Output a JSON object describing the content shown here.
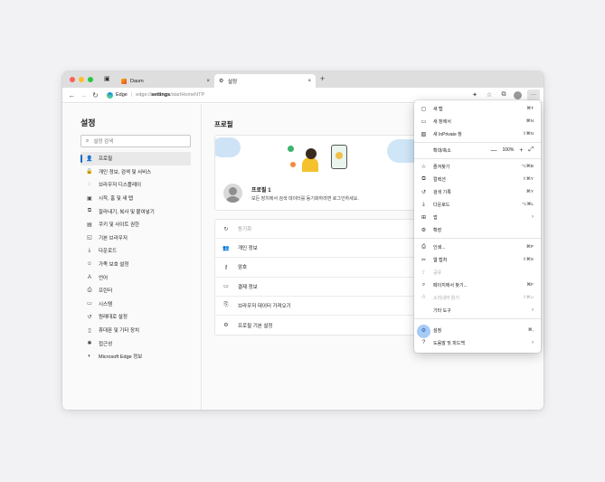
{
  "window": {
    "tabs": [
      {
        "title": "Daum",
        "close": "×"
      },
      {
        "title": "설정",
        "close": "×"
      }
    ],
    "new_tab": "+",
    "address": {
      "browser": "Edge",
      "url_prefix": "edge://",
      "url_bold": "settings",
      "url_rest": "/startHomeNTP"
    }
  },
  "sidebar": {
    "title": "설정",
    "search_placeholder": "설정 검색",
    "items": [
      {
        "label": "프로필",
        "icon": "👤"
      },
      {
        "label": "개인 정보, 검색 및 서비스",
        "icon": "🔒"
      },
      {
        "label": "브라우저 디스플레이",
        "icon": "◌"
      },
      {
        "label": "시작, 홈 및 새 탭",
        "icon": "▣"
      },
      {
        "label": "잘라내기, 복사 및 붙여넣기",
        "icon": "⧉"
      },
      {
        "label": "쿠키 및 사이트 권한",
        "icon": "▤"
      },
      {
        "label": "기본 브라우저",
        "icon": "◱"
      },
      {
        "label": "다운로드",
        "icon": "⤓"
      },
      {
        "label": "가족 보호 설정",
        "icon": "☺"
      },
      {
        "label": "언어",
        "icon": "A"
      },
      {
        "label": "프린터",
        "icon": "⎙"
      },
      {
        "label": "시스템",
        "icon": "▭"
      },
      {
        "label": "원래대로 설정",
        "icon": "↺"
      },
      {
        "label": "휴대폰 및 기타 장치",
        "icon": "▯"
      },
      {
        "label": "접근성",
        "icon": "✱"
      },
      {
        "label": "Microsoft Edge 정보",
        "icon": "◐"
      }
    ]
  },
  "main": {
    "title": "프로필",
    "profile": {
      "name": "프로필 1",
      "desc": "모든 장치에서 검색 데이터를 동기화하려면 로그인하세요."
    },
    "rows": [
      {
        "label": "동기화",
        "icon": "↻"
      },
      {
        "label": "개인 정보",
        "icon": "👥"
      },
      {
        "label": "암호",
        "icon": "⚷"
      },
      {
        "label": "결제 정보",
        "icon": "▭"
      },
      {
        "label": "브라우저 데이터 가져오기",
        "icon": "⎘"
      },
      {
        "label": "프로필 기본 설정",
        "icon": "⚙"
      }
    ]
  },
  "menu": {
    "items": [
      {
        "label": "새 탭",
        "shortcut": "⌘T",
        "icon": "▢"
      },
      {
        "label": "새 창에서",
        "shortcut": "⌘N",
        "icon": "▭"
      },
      {
        "label": "새 InPrivate 창",
        "shortcut": "⇧⌘N",
        "icon": "▨"
      },
      {
        "label": "확대/축소",
        "zoom_minus": "—",
        "zoom_value": "100%",
        "zoom_plus": "+",
        "zoom_full": "⤢"
      },
      {
        "label": "즐겨찾기",
        "shortcut": "⌥⌘B",
        "icon": "☆"
      },
      {
        "label": "컬렉션",
        "shortcut": "⇧⌘Y",
        "icon": "⧉"
      },
      {
        "label": "검색 기록",
        "shortcut": "⌘Y",
        "icon": "↺"
      },
      {
        "label": "다운로드",
        "shortcut": "⌥⌘L",
        "icon": "⤓"
      },
      {
        "label": "앱",
        "icon": "⊞"
      },
      {
        "label": "확장",
        "icon": "⚙"
      },
      {
        "label": "인쇄...",
        "shortcut": "⌘P",
        "icon": "⎙"
      },
      {
        "label": "웹 캡처",
        "shortcut": "⇧⌘S",
        "icon": "✂"
      },
      {
        "label": "공유",
        "icon": "⇪"
      },
      {
        "label": "페이지에서 찾기...",
        "shortcut": "⌘F",
        "icon": "⌕"
      },
      {
        "label": "소리내어 읽기",
        "shortcut": "⇧⌘U",
        "icon": "A"
      },
      {
        "label": "기타 도구"
      },
      {
        "label": "설정",
        "shortcut": "⌘,",
        "icon": "⚙"
      },
      {
        "label": "도움말 및 피드백",
        "icon": "?"
      }
    ]
  }
}
